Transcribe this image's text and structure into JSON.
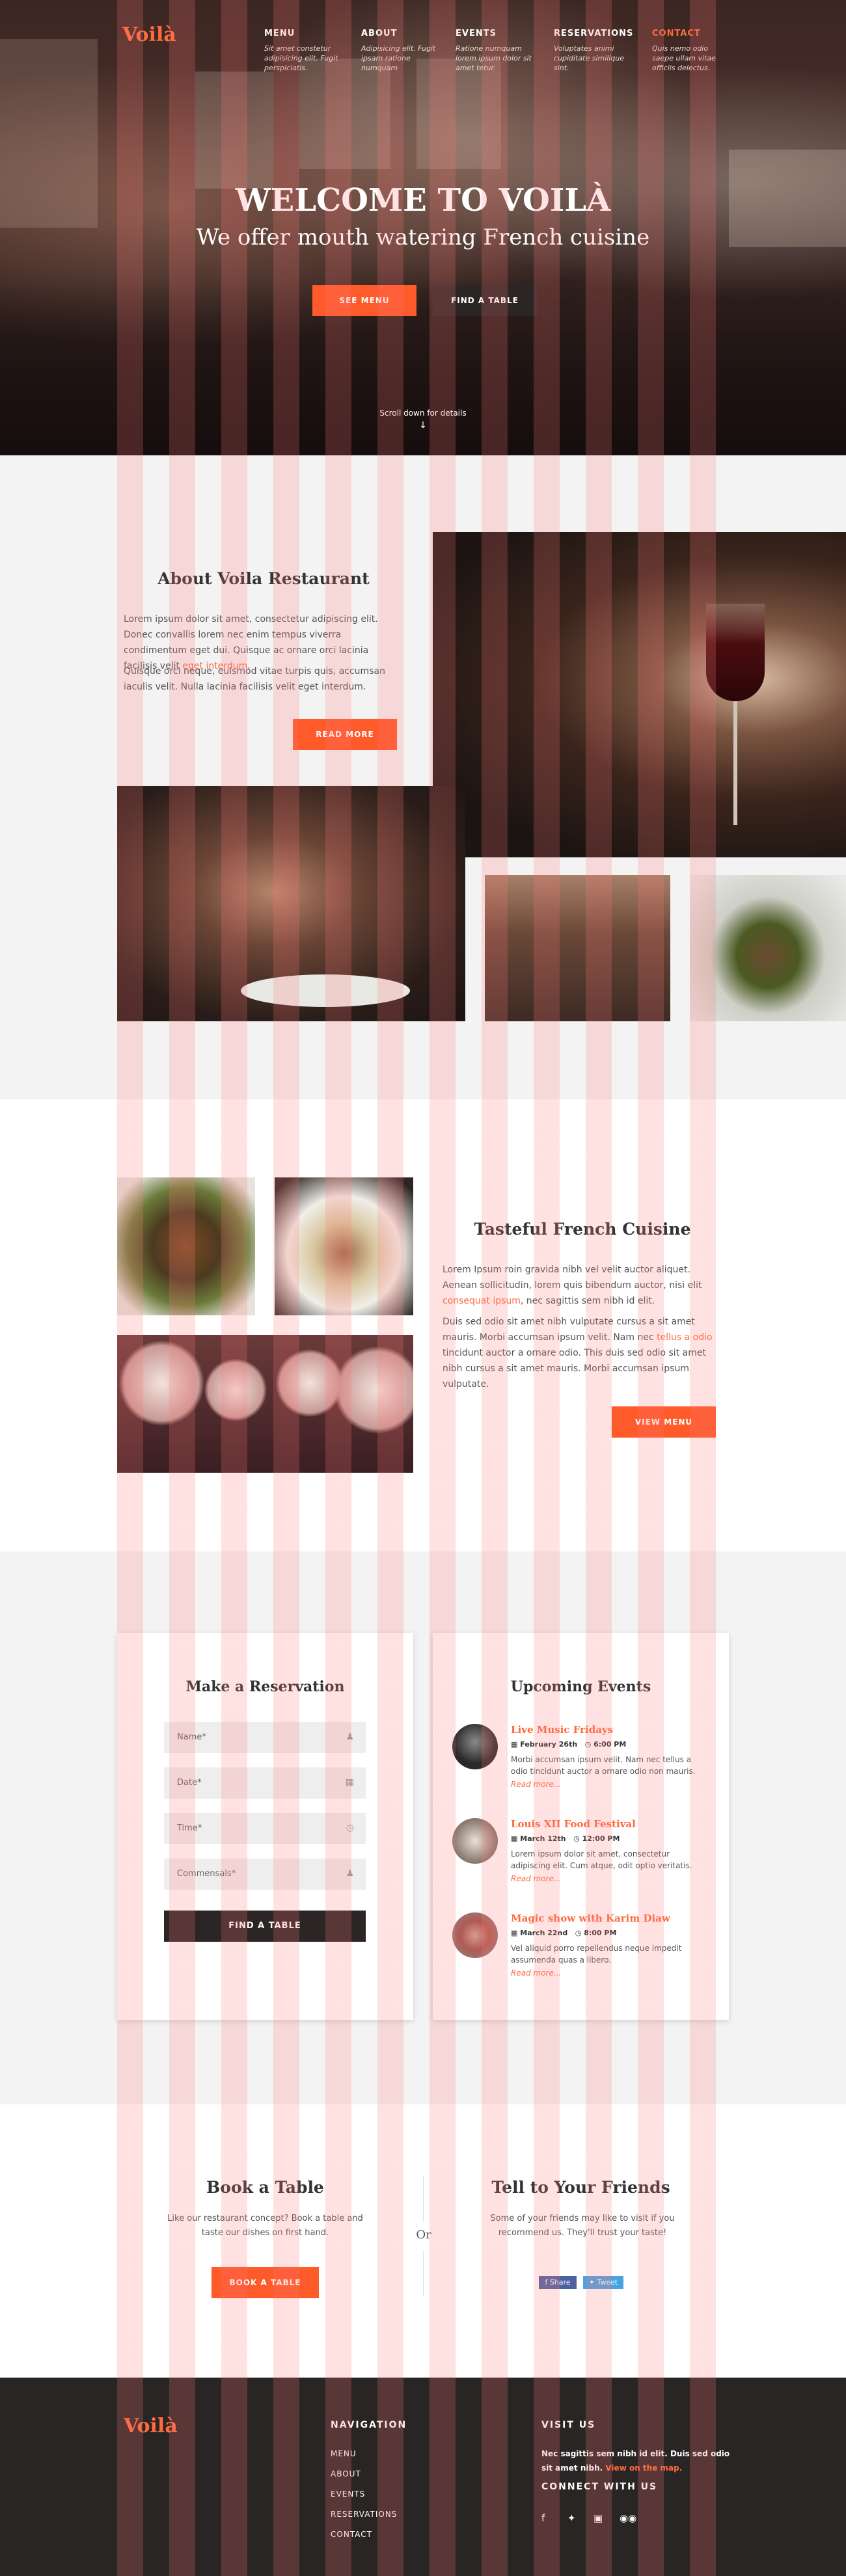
{
  "brand": {
    "logo": "Voilà",
    "accent": "#ff5a2a"
  },
  "nav": [
    {
      "label": "MENU",
      "sub": "Sit amet constetur adipisicing elit. Fugit perspiciatis."
    },
    {
      "label": "ABOUT",
      "sub": "Adipisicing elit. Fugit ipsam ratione numquam"
    },
    {
      "label": "EVENTS",
      "sub": "Ratione numquam lorem ipsum dolor sit amet tetur."
    },
    {
      "label": "RESERVATIONS",
      "sub": "Voluptates animi cupiditate similique sint."
    },
    {
      "label": "CONTACT",
      "sub": "Quis nemo odio saepe ullam vitae officiis delectus."
    }
  ],
  "hero": {
    "title": "WELCOME TO VOILÀ",
    "subtitle": "We offer mouth watering French cuisine",
    "see_menu": "SEE MENU",
    "find_table": "FIND A TABLE",
    "scroll": "Scroll down for details"
  },
  "about": {
    "title": "About Voila Restaurant",
    "p1_a": "Lorem ipsum dolor sit amet, consectetur adipiscing elit. Donec convallis lorem nec enim tempus viverra condimentum eget dui. Quisque ac ornare orci lacinia facilisis velit ",
    "p1_link": "eget interdum",
    "p1_b": ".",
    "p2": "Quisque orci neque, euismod vitae turpis quis, accumsan iaculis velit. Nulla lacinia facilisis velit eget interdum.",
    "button": "READ MORE"
  },
  "cuisine": {
    "title": "Tasteful French Cuisine",
    "p1_a": "Lorem Ipsum roin gravida nibh vel velit auctor aliquet. Aenean sollicitudin, lorem quis bibendum auctor, nisi elit ",
    "p1_link": "consequat ipsum",
    "p1_b": ", nec sagittis sem nibh id elit.",
    "p2_a": "Duis sed odio sit amet nibh vulputate cursus a sit amet mauris. Morbi accumsan ipsum velit. Nam nec ",
    "p2_link": "tellus a odio",
    "p2_b": " tincidunt auctor a ornare odio. This duis sed odio sit amet nibh cursus a sit amet mauris. Morbi accumsan ipsum vulputate.",
    "button": "VIEW MENU"
  },
  "reservation": {
    "title": "Make a Reservation",
    "fields": [
      "Name*",
      "Date*",
      "Time*",
      "Commensals*"
    ],
    "button": "FIND A TABLE"
  },
  "events": {
    "title": "Upcoming Events",
    "read_more": "Read more...",
    "items": [
      {
        "title": "Live Music Fridays",
        "date": "February 26th",
        "time": "6:00 PM",
        "text": "Morbi accumsan ipsum velit. Nam nec tellus a odio tincidunt auctor a ornare odio non mauris."
      },
      {
        "title": "Louis XII Food Festival",
        "date": "March 12th",
        "time": "12:00 PM",
        "text": "Lorem ipsum dolor sit amet, consectetur adipiscing elit. Cum atque, odit optio veritatis."
      },
      {
        "title": "Magic show with Karim Diaw",
        "date": "March 22nd",
        "time": "8:00 PM",
        "text": "Vel aliquid porro repellendus neque impedit assumenda quas a libero."
      }
    ]
  },
  "book": {
    "title": "Book a Table",
    "text": "Like our restaurant concept? Book a table and taste our dishes on first hand.",
    "button": "BOOK A TABLE",
    "or": "Or"
  },
  "tell": {
    "title": "Tell to Your Friends",
    "text": "Some of your friends may like to visit if you recommend us. They'll trust your taste!",
    "share": "Share",
    "tweet": "Tweet"
  },
  "footer": {
    "logo": "Voilà",
    "nav_title": "NAVIGATION",
    "nav_items": [
      "MENU",
      "ABOUT",
      "EVENTS",
      "RESERVATIONS",
      "CONTACT"
    ],
    "visit_title": "VISIT US",
    "visit_text": "Nec sagittis sem nibh id elit. Duis sed odio sit amet nibh. ",
    "visit_link": "View on the map.",
    "connect_title": "CONNECT WITH US",
    "social": [
      "facebook-icon",
      "twitter-icon",
      "instagram-icon",
      "tripadvisor-icon"
    ]
  }
}
